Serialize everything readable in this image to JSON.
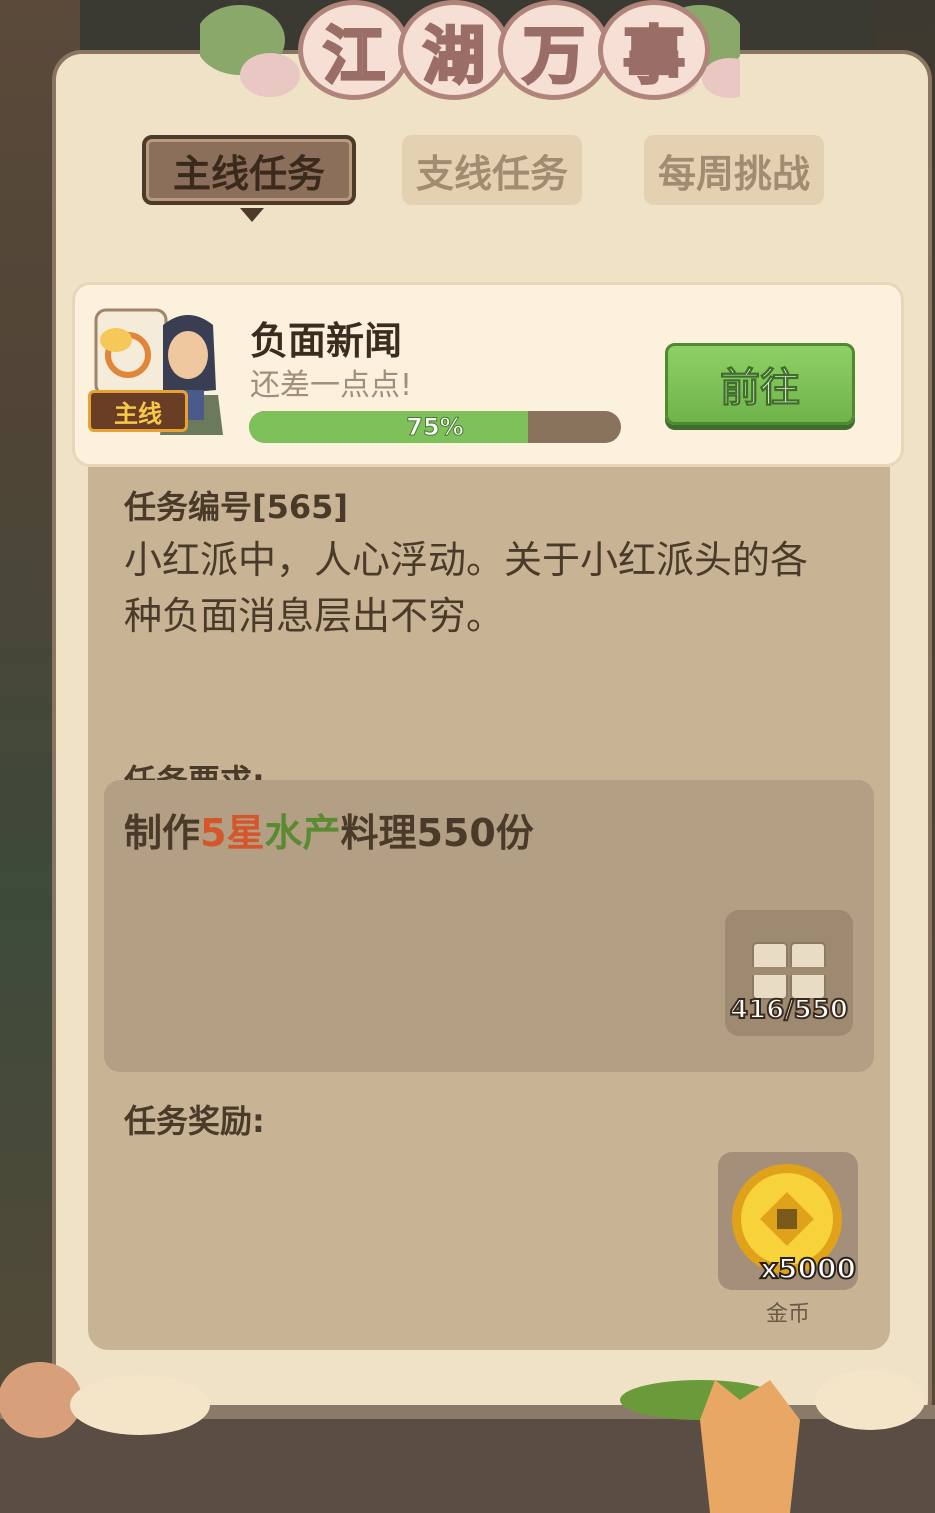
{
  "header": {
    "title_chars": [
      "江",
      "湖",
      "万",
      "事"
    ]
  },
  "tabs": [
    {
      "label": "主线任务",
      "active": true
    },
    {
      "label": "支线任务",
      "active": false
    },
    {
      "label": "每周挑战",
      "active": false
    }
  ],
  "task": {
    "badge": "主线",
    "title": "负面新闻",
    "subtitle": "还差一点点!",
    "progress_value": 0.75,
    "progress_label": "75%",
    "go_button": "前往"
  },
  "detail": {
    "number_label": "任务编号[565]",
    "description": "小红派中，人心浮动。关于小红派头的各种负面消息层出不穷。",
    "requirement_label": "任务要求:",
    "requirement": {
      "prefix": "制作",
      "star": "5星",
      "category": "水产",
      "suffix": "料理550份"
    },
    "requirement_item_count": "416/550",
    "reward_label": "任务奖励:",
    "reward": {
      "count": "x5000",
      "name": "金币",
      "icon": "gold-coin-icon"
    }
  },
  "colors": {
    "accent_green": "#7ec05a",
    "star_orange": "#d4562a",
    "category_green": "#5a8a32"
  }
}
